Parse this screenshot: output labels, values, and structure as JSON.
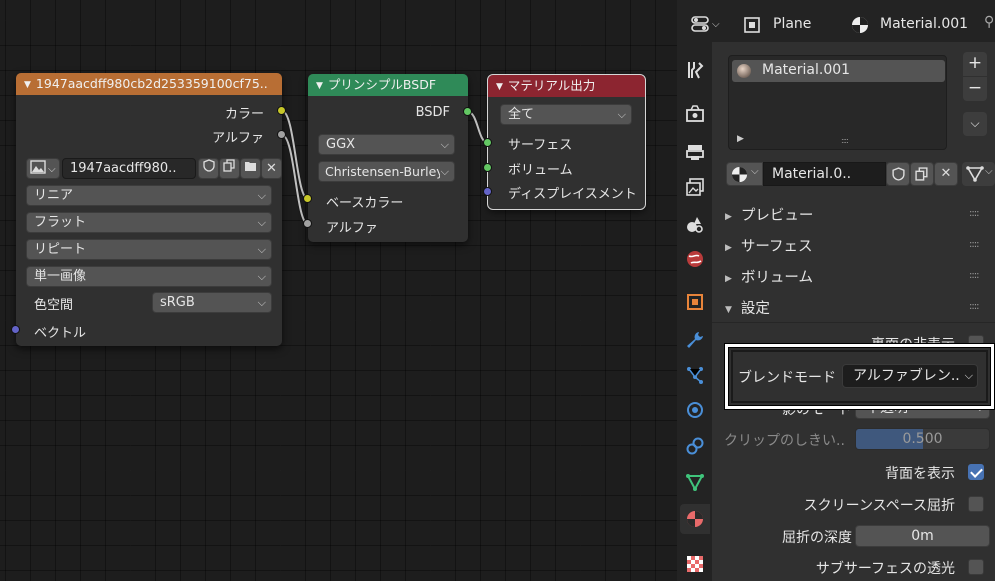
{
  "colors": {
    "node_texture_header": "#b86e34",
    "node_bsdf_header": "#2f8a58",
    "node_output_header": "#8c2530",
    "socket_color": "#c7c729",
    "socket_float": "#a1a1a1",
    "socket_shader": "#63c763",
    "socket_vector": "#6363c7",
    "accent_blue": "#4772b3",
    "highlight_box": "#ffffff"
  },
  "nodes": {
    "image_texture": {
      "title": "1947aacdff980cb2d253359100cf75..",
      "output_color": "カラー",
      "output_alpha": "アルファ",
      "image_name": "1947aacdff980..",
      "interpolation": "リニア",
      "projection": "フラット",
      "extension": "リピート",
      "source": "単一画像",
      "colorspace_label": "色空間",
      "colorspace_value": "sRGB",
      "input_vector": "ベクトル"
    },
    "principled": {
      "title": "プリンシプルBSDF",
      "output_bsdf": "BSDF",
      "distribution": "GGX",
      "subsurface_method": "Christensen-Burley",
      "input_base_color": "ベースカラー",
      "input_alpha": "アルファ"
    },
    "material_output": {
      "title": "マテリアル出力",
      "target": "全て",
      "input_surface": "サーフェス",
      "input_volume": "ボリューム",
      "input_displacement": "ディスプレイスメント"
    }
  },
  "properties": {
    "header": {
      "object_name": "Plane",
      "material_name": "Material.001"
    },
    "slot_list": {
      "item": "Material.001",
      "plus": "+",
      "minus": "−"
    },
    "material_field": "Material.0..",
    "panels": {
      "preview": "プレビュー",
      "surface": "サーフェス",
      "volume": "ボリューム",
      "settings": "設定"
    },
    "settings": {
      "backface_hide": "裏面の非表示",
      "blend_mode_label": "ブレンドモード",
      "blend_mode_value": "アルファブレン..",
      "shadow_mode_label": "影のモード",
      "shadow_mode_value": "不透明",
      "clip_threshold_label": "クリップのしきい..",
      "clip_threshold_value": "0.500",
      "clip_threshold_fraction": 0.5,
      "show_backface": "背面を表示",
      "show_backface_checked": true,
      "screen_space_refraction": "スクリーンスペース屈折",
      "refraction_depth_label": "屈折の深度",
      "refraction_depth_value": "0m",
      "subsurface_translucency": "サブサーフェスの透光"
    }
  }
}
